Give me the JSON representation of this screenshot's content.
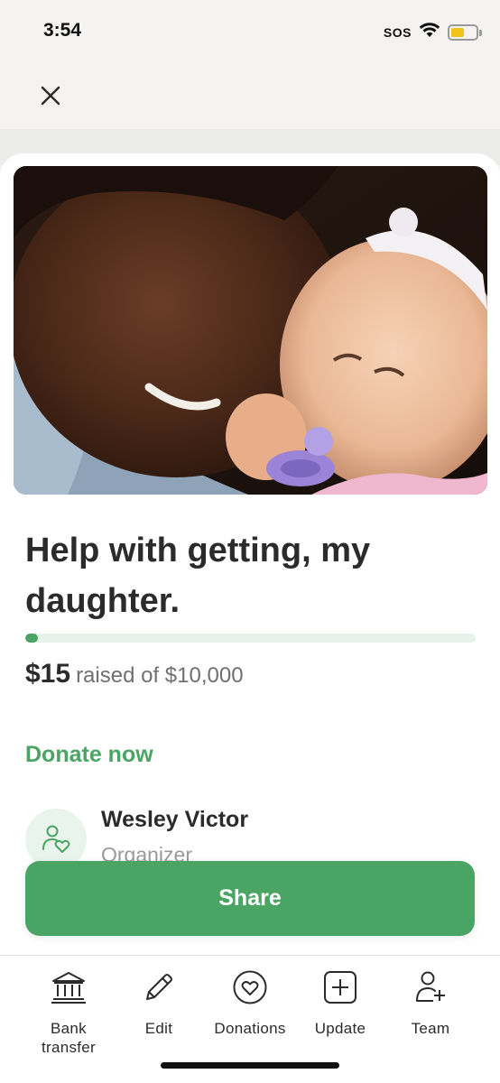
{
  "status_bar": {
    "time": "3:54",
    "carrier": "SOS",
    "battery_level": 0.55
  },
  "header": {
    "close_icon": "close-icon"
  },
  "campaign": {
    "title": "Help with getting, my daughter.",
    "raised_amount": "$15",
    "raised_text": "raised of $10,000",
    "progress_fraction": 0.0015,
    "donate_label": "Donate now",
    "organizer": {
      "name": "Wesley Victor",
      "role": "Organizer"
    }
  },
  "share_label": "Share",
  "tabs": [
    {
      "label": "Bank transfer",
      "icon": "bank-icon"
    },
    {
      "label": "Edit",
      "icon": "pencil-icon"
    },
    {
      "label": "Donations",
      "icon": "heart-icon"
    },
    {
      "label": "Update",
      "icon": "plus-square-icon"
    },
    {
      "label": "Team",
      "icon": "add-person-icon"
    }
  ],
  "colors": {
    "accent": "#4aa564",
    "progress_track": "#e6f2ea"
  }
}
